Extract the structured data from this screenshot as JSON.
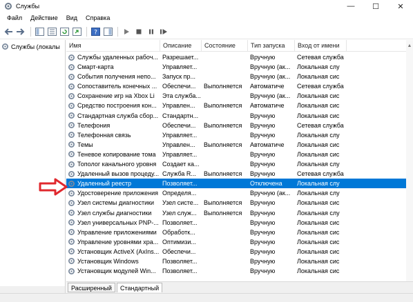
{
  "window": {
    "title": "Службы",
    "minimize_glyph": "—",
    "maximize_glyph": "☐",
    "close_glyph": "✕"
  },
  "menu": [
    "Файл",
    "Действие",
    "Вид",
    "Справка"
  ],
  "toolbar": {
    "icons": [
      "back-arrow-icon",
      "forward-arrow-icon",
      "console-tree-icon",
      "properties-list-icon",
      "refresh-icon",
      "export-list-icon",
      "help-icon",
      "action-pane-icon",
      "play-icon",
      "stop-icon",
      "pause-icon",
      "restart-icon"
    ]
  },
  "tree": {
    "root_label": "Службы (локалы"
  },
  "columns": {
    "name": "Имя",
    "description": "Описание",
    "state": "Состояние",
    "startup": "Тип запуска",
    "logon": "Вход от имени"
  },
  "services": [
    {
      "name": "Службы удаленных рабоч...",
      "desc": "Разрешает...",
      "state": "",
      "start": "Вручную",
      "logon": "Сетевая служба"
    },
    {
      "name": "Смарт-карта",
      "desc": "Управляет...",
      "state": "",
      "start": "Вручную (ак...",
      "logon": "Локальная слу"
    },
    {
      "name": "События получения непо...",
      "desc": "Запуск пр...",
      "state": "",
      "start": "Вручную (ак...",
      "logon": "Локальная сис"
    },
    {
      "name": "Сопоставитель конечных ...",
      "desc": "Обеспечи...",
      "state": "Выполняется",
      "start": "Автоматиче",
      "logon": "Сетевая служба"
    },
    {
      "name": "Сохранение игр на Xbox Li",
      "desc": "Эта служба...",
      "state": "",
      "start": "Вручную (ак...",
      "logon": "Локальная сис"
    },
    {
      "name": "Средство построения кон...",
      "desc": "Управлен...",
      "state": "Выполняется",
      "start": "Автоматиче",
      "logon": "Локальная сис"
    },
    {
      "name": "Стандартная служба сбор...",
      "desc": "Стандартн...",
      "state": "",
      "start": "Вручную",
      "logon": "Локальная сис"
    },
    {
      "name": "Телефония",
      "desc": "Обеспечи...",
      "state": "Выполняется",
      "start": "Вручную",
      "logon": "Сетевая служба"
    },
    {
      "name": "Телефонная связь",
      "desc": "Управляет...",
      "state": "",
      "start": "Вручную",
      "logon": "Локальная слу"
    },
    {
      "name": "Темы",
      "desc": "Управлен...",
      "state": "Выполняется",
      "start": "Автоматиче",
      "logon": "Локальная сис"
    },
    {
      "name": "Теневое копирование тома",
      "desc": "Управляет...",
      "state": "",
      "start": "Вручную",
      "logon": "Локальная сис"
    },
    {
      "name": "Тополог канального уровня",
      "desc": "Создает ка...",
      "state": "",
      "start": "Вручную",
      "logon": "Локальная слу"
    },
    {
      "name": "Удаленный вызов процеду...",
      "desc": "Служба R...",
      "state": "Выполняется",
      "start": "Вручную",
      "logon": "Сетевая служба"
    },
    {
      "name": "Удаленный реестр",
      "desc": "Позволяет...",
      "state": "",
      "start": "Отключена",
      "logon": "Локальная слу"
    },
    {
      "name": "Удостоверение приложения",
      "desc": "Определя...",
      "state": "",
      "start": "Вручную (ак...",
      "logon": "Локальная слу"
    },
    {
      "name": "Узел системы диагностики",
      "desc": "Узел систе...",
      "state": "Выполняется",
      "start": "Вручную",
      "logon": "Локальная сис"
    },
    {
      "name": "Узел службы диагностики",
      "desc": "Узел служ...",
      "state": "Выполняется",
      "start": "Вручную",
      "logon": "Локальная слу"
    },
    {
      "name": "Узел универсальных PNP-...",
      "desc": "Позволяет...",
      "state": "",
      "start": "Вручную",
      "logon": "Локальная сис"
    },
    {
      "name": "Управление приложениями",
      "desc": "Обработк...",
      "state": "",
      "start": "Вручную",
      "logon": "Локальная сис"
    },
    {
      "name": "Управление уровнями хра...",
      "desc": "Оптимизи...",
      "state": "",
      "start": "Вручную",
      "logon": "Локальная сис"
    },
    {
      "name": "Установщик ActiveX (AxIns...",
      "desc": "Обеспечи...",
      "state": "",
      "start": "Вручную",
      "logon": "Локальная сис"
    },
    {
      "name": "Установщик Windows",
      "desc": "Позволяет...",
      "state": "",
      "start": "Вручную",
      "logon": "Локальная сис"
    },
    {
      "name": "Установщик модулей Win...",
      "desc": "Позволяет...",
      "state": "",
      "start": "Вручную",
      "logon": "Локальная сис"
    }
  ],
  "selected_index": 13,
  "tabs": [
    "Расширенный",
    "Стандартный"
  ],
  "colors": {
    "selection": "#0078d7",
    "annotation_arrow": "#e0282e"
  }
}
